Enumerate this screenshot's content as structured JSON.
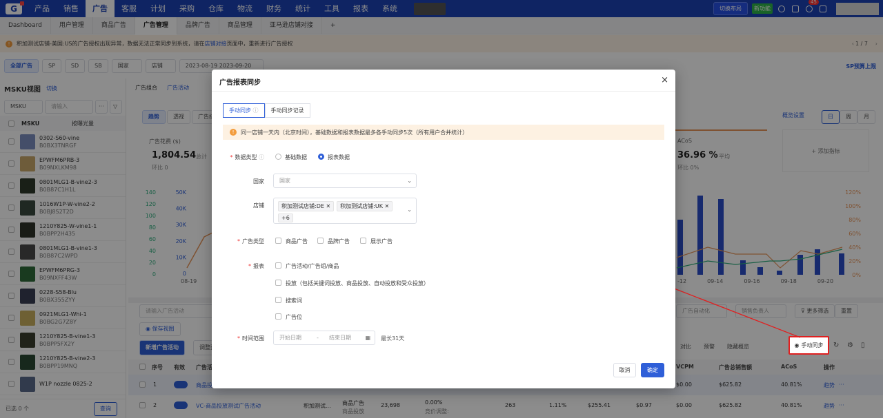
{
  "topnav": {
    "logo": "G",
    "items": [
      "产品",
      "销售",
      "广告",
      "客服",
      "计划",
      "采购",
      "仓库",
      "物流",
      "财务",
      "统计",
      "工具",
      "报表",
      "系统"
    ],
    "active_index": 2,
    "switch_layout": "切换布局",
    "new_function": "新功能",
    "notification_count": "45",
    "accent": "#1d43b4"
  },
  "tabs": [
    "Dashboard",
    "用户管理",
    "商品广告",
    "广告管理",
    "品牌广告",
    "商品管理",
    "亚马逊店铺对接",
    "+"
  ],
  "active_tab": 3,
  "notice": {
    "prefix": "积加测试店铺-美国:US的广告授权出现异常，数据无法正常同步到系统，请在 ",
    "link": "店铺对接",
    "suffix": " 页面中，重新进行广告授权",
    "pager": "1 / 7"
  },
  "filters": {
    "all_ads": "全部广告",
    "sp": "SP",
    "sd": "SD",
    "sb": "SB",
    "country": "国家",
    "store": "店铺",
    "date_start": "2023-08-19",
    "date_end": "2023-09-20",
    "sp_budget": "SP预算上限"
  },
  "sidebar": {
    "title": "MSKU视图",
    "switch": "切换",
    "msku_select": "MSKU",
    "search_placeholder": "请输入",
    "col_msku": "MSKU",
    "sort": "按曝光量",
    "footer_count": "已选 0 个",
    "query_btn": "查询",
    "items": [
      {
        "sku": "0302-S60-vine",
        "asin": "B0BX3TNRGF",
        "color": "#7d8fc0"
      },
      {
        "sku": "EPWFM6PRB-3",
        "asin": "B09NXLKM98",
        "color": "#c9a86a"
      },
      {
        "sku": "0801MLG1-B-vine2-3",
        "asin": "B0B87C1H1L",
        "color": "#2e3a2a"
      },
      {
        "sku": "1016W1P-W-vine2-2",
        "asin": "B0BJ8S2T2D",
        "color": "#3a4a3f"
      },
      {
        "sku": "1210Y825-W-vine1-1",
        "asin": "B0BPP2H435",
        "color": "#2f3328"
      },
      {
        "sku": "0801MLG1-B-vine1-3",
        "asin": "B0B87C2WPD",
        "color": "#4a4a4a"
      },
      {
        "sku": "EPWFM6PRG-3",
        "asin": "B09NXFF43W",
        "color": "#2f6a3a"
      },
      {
        "sku": "0228-S58-Blu",
        "asin": "B0BX355ZYY",
        "color": "#3a3f55"
      },
      {
        "sku": "0921MLG1-Whi-1",
        "asin": "B0BG2G7Z8Y",
        "color": "#c9b060"
      },
      {
        "sku": "1210Y825-B-vine1-3",
        "asin": "B0BPP5FX2Y",
        "color": "#3b3f2f"
      },
      {
        "sku": "1210Y825-B-vine2-3",
        "asin": "B0BPP19MNQ",
        "color": "#2b4a33"
      },
      {
        "sku": "W1P nozzle 0825-2",
        "asin": "",
        "color": "#5a6a8a"
      }
    ]
  },
  "main": {
    "sub_tabs": [
      "广告组合",
      "广告活动"
    ],
    "view_tabs": [
      "趋势",
      "透视",
      "广告结"
    ],
    "metric_spend_label": "广告花费 ($)",
    "metric_spend_value": "1,804.54",
    "metric_spend_suffix": "总计",
    "metric_ratio": "环比",
    "metric_ratio_val": "0",
    "metric_acos_label": "ACoS",
    "metric_acos_value": "36.96 %",
    "metric_acos_suffix": "平均",
    "metric_acos_ratio": "环比",
    "metric_acos_ratio_val": "0%",
    "add_metric": "+ 添加指标",
    "overview_settings": "概览设置",
    "granularity": [
      "日",
      "周",
      "月"
    ],
    "left_axis": [
      "140",
      "120",
      "100",
      "80",
      "60",
      "40",
      "20",
      "0"
    ],
    "left_axis2": [
      "50K",
      "40K",
      "30K",
      "20K",
      "10K",
      "0"
    ],
    "right_axis": [
      "120%",
      "100%",
      "80%",
      "60%",
      "40%",
      "20%",
      "0%"
    ],
    "x_left": [
      "08-19"
    ],
    "x_right": [
      "-12",
      "09-14",
      "09-16",
      "09-18",
      "09-20"
    ],
    "search_campaign": "请输入广告活动",
    "save_view": "保存视图",
    "new_campaign": "新增广告活动",
    "adjust": "调整预",
    "ad_automation": "广告自动化",
    "sales_owner": "销售负责人",
    "more_filters": "更多筛选",
    "reset": "重置",
    "compare": "对比",
    "alert": "预警",
    "hide_overview": "隐藏概览",
    "manual_sync": "手动同步",
    "table_headers": [
      "序号",
      "有效",
      "广告活",
      "VCPM",
      "广告总销售额",
      "ACoS",
      "操作"
    ],
    "rows": [
      {
        "idx": "1",
        "name": "商品投",
        "vcpm": "$0.00",
        "sales": "$625.82",
        "acos": "40.81%",
        "op": "趋势"
      },
      {
        "idx": "2",
        "name": "VC-商品投放测试广告活动",
        "store": "积加测试...",
        "type": "商品广告",
        "type2": "商品投放",
        "impr": "23,698",
        "pct": "0.00%",
        "bid": "竞价调整:",
        "clicks": "263",
        "ctr": "1.11%",
        "spend": "$255.41",
        "cpc": "$0.97",
        "vcpm": "$0.00",
        "sales": "$625.82",
        "acos": "40.81%",
        "op": "趋势"
      }
    ]
  },
  "modal": {
    "title": "广告报表同步",
    "tab_manual": "手动同步",
    "tab_records": "手动同步记录",
    "notice": "同一店铺一天内（北京时间），基础数据和报表数据最多各手动同步5次（所有用户合并统计）",
    "data_type_label": "数据类型",
    "data_type_options": [
      "基础数据",
      "报表数据"
    ],
    "data_type_selected": 1,
    "country_label": "国家",
    "country_placeholder": "国家",
    "store_label": "店铺",
    "store_tags": [
      "积加测试店铺:DE",
      "积加测试店铺:UK"
    ],
    "store_more": "+6",
    "ad_type_label": "广告类型",
    "ad_type_options": [
      "商品广告",
      "品牌广告",
      "展示广告"
    ],
    "report_label": "报表",
    "report_options": [
      "广告活动/广告组/商品",
      "投放（包括关键词投放、商品投放、自动投放和受众投放）",
      "搜索词",
      "广告位"
    ],
    "time_label": "时间范围",
    "start_placeholder": "开始日期",
    "end_placeholder": "结束日期",
    "range_sep": "-",
    "max_days": "最长31天",
    "cancel": "取消",
    "ok": "确定"
  }
}
